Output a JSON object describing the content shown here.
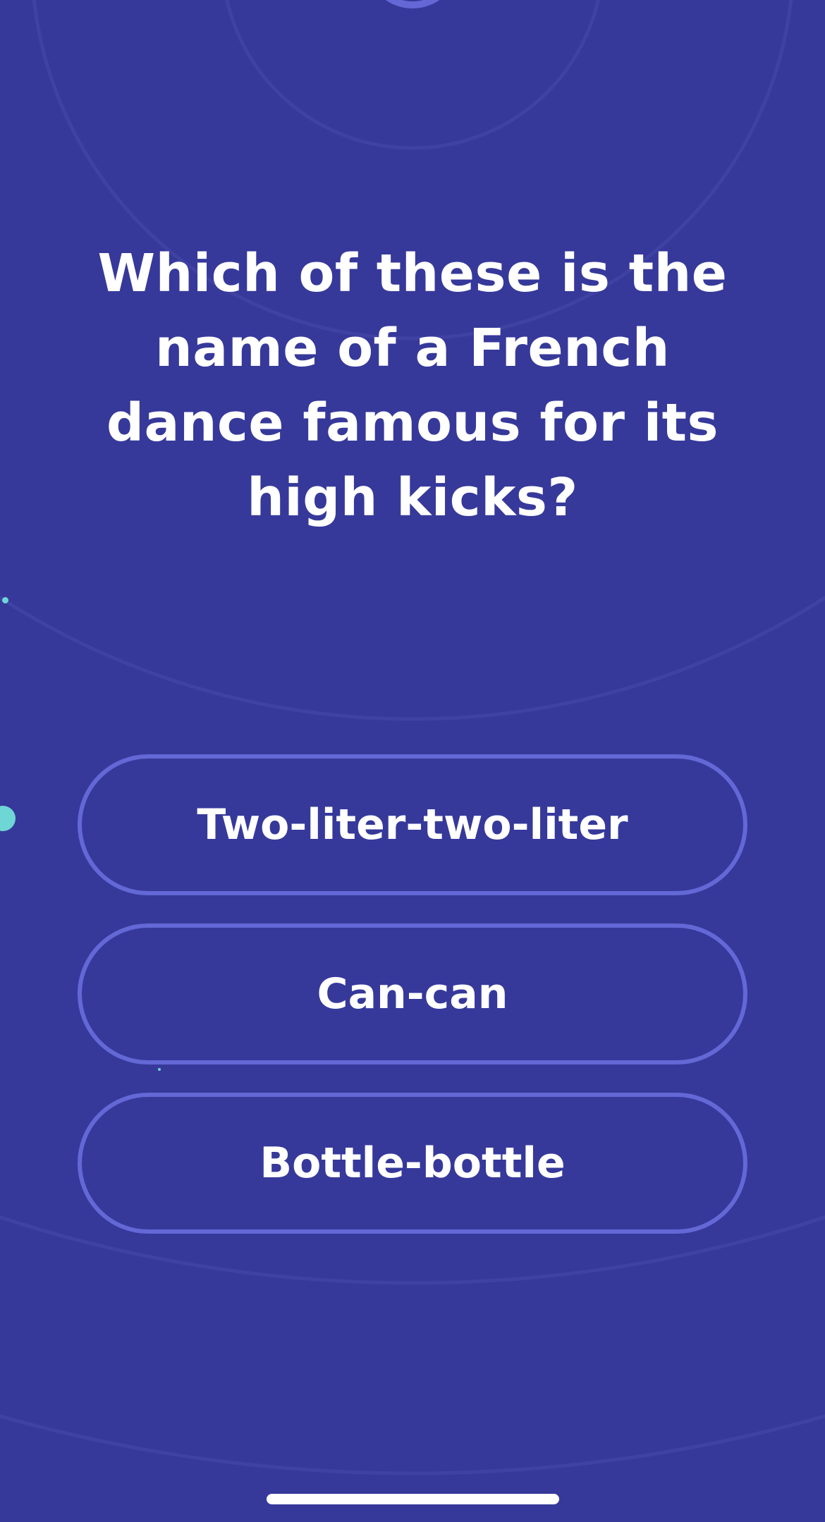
{
  "question": {
    "text": "Which of these is the name of a French dance famous for its high kicks?"
  },
  "answers": [
    {
      "label": "Two-liter-two-liter"
    },
    {
      "label": "Can-can"
    },
    {
      "label": "Bottle-bottle"
    }
  ],
  "colors": {
    "background": "#36399a",
    "answer_border": "#6468d6",
    "text": "#ffffff",
    "accent_dot": "#6fd6d6",
    "ring": "#4346a6"
  },
  "icons": {
    "timer": "timer-ring-icon"
  }
}
